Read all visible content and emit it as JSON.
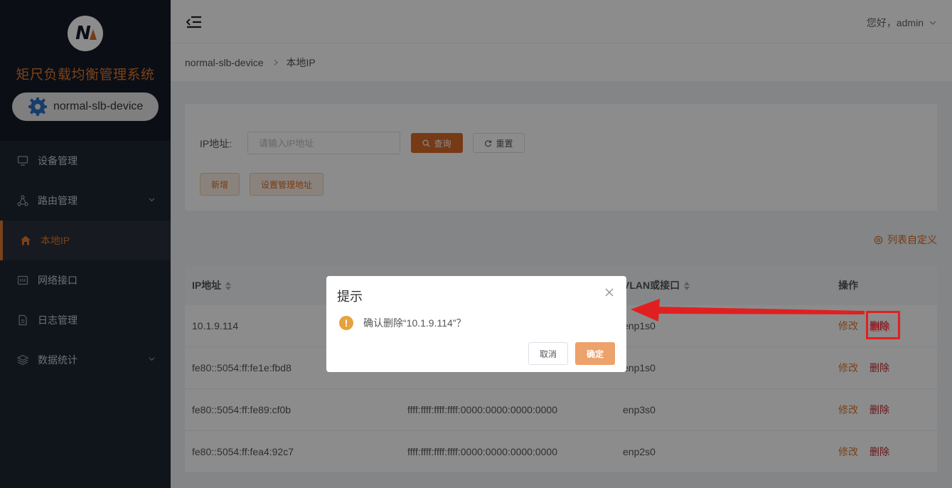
{
  "sidebar": {
    "logo_letter": "N",
    "app_title": "矩尺负载均衡管理系统",
    "device_name": "normal-slb-device",
    "items": [
      {
        "label": "设备管理",
        "icon": "monitor-icon",
        "has_children": false,
        "active": false
      },
      {
        "label": "路由管理",
        "icon": "network-icon",
        "has_children": true,
        "active": false
      },
      {
        "label": "本地IP",
        "icon": "home-icon",
        "has_children": false,
        "active": true
      },
      {
        "label": "网络接口",
        "icon": "interface-icon",
        "has_children": false,
        "active": false
      },
      {
        "label": "日志管理",
        "icon": "document-icon",
        "has_children": false,
        "active": false
      },
      {
        "label": "数据统计",
        "icon": "layers-icon",
        "has_children": true,
        "active": false
      }
    ]
  },
  "header": {
    "greeting": "您好，admin"
  },
  "breadcrumb": {
    "items": [
      "normal-slb-device",
      "本地IP"
    ]
  },
  "search": {
    "ip_label": "IP地址:",
    "ip_placeholder": "请输入IP地址",
    "query_label": "查询",
    "reset_label": "重置",
    "add_label": "新增",
    "set_mgmt_label": "设置管理地址"
  },
  "column_custom_label": "列表自定义",
  "table": {
    "headers": [
      "IP地址",
      "",
      "VLAN或接口",
      "操作"
    ],
    "rows": [
      {
        "ip": "10.1.9.114",
        "mask": "",
        "iface": "enp1s0",
        "edit": "修改",
        "delete": "删除"
      },
      {
        "ip": "fe80::5054:ff:fe1e:fbd8",
        "mask": "",
        "iface": "enp1s0",
        "edit": "修改",
        "delete": "删除"
      },
      {
        "ip": "fe80::5054:ff:fe89:cf0b",
        "mask": "ffff:ffff:ffff:ffff:0000:0000:0000:0000",
        "iface": "enp3s0",
        "edit": "修改",
        "delete": "删除"
      },
      {
        "ip": "fe80::5054:ff:fea4:92c7",
        "mask": "ffff:ffff:ffff:ffff:0000:0000:0000:0000",
        "iface": "enp2s0",
        "edit": "修改",
        "delete": "删除"
      }
    ]
  },
  "dialog": {
    "title": "提示",
    "warn_glyph": "!",
    "message": "确认删除“10.1.9.114”？",
    "cancel_label": "取消",
    "ok_label": "确定"
  },
  "annotation": {
    "highlight_label": "删除",
    "arrow_color": "#e02020"
  }
}
